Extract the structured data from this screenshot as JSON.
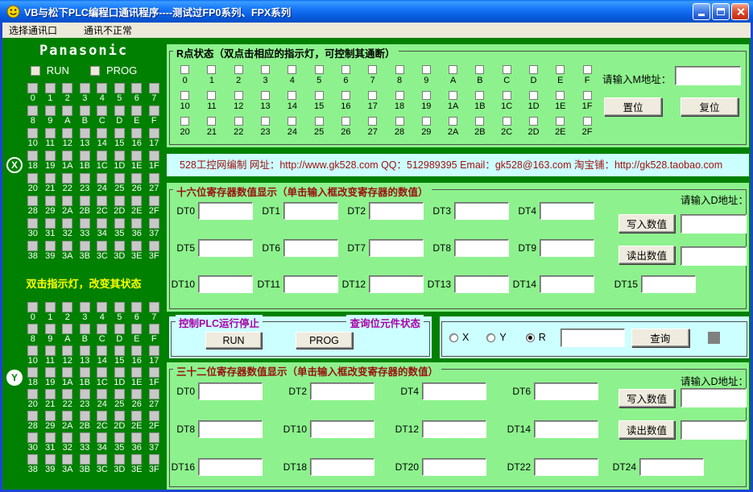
{
  "window": {
    "title": "VB与松下PLC编程口通讯程序----测试过FP0系列、FPX系列"
  },
  "menu": {
    "items": [
      "选择通讯口",
      "通讯不正常"
    ]
  },
  "left_panel": {
    "brand": "Panasonic",
    "run_label": "RUN",
    "prog_label": "PROG",
    "hint": "双击指示灯，改变其状态",
    "x_badge": "X",
    "y_badge": "Y",
    "grid_labels": [
      "0",
      "1",
      "2",
      "3",
      "4",
      "5",
      "6",
      "7",
      "8",
      "9",
      "A",
      "B",
      "C",
      "D",
      "E",
      "F",
      "10",
      "11",
      "12",
      "13",
      "14",
      "15",
      "16",
      "17",
      "18",
      "19",
      "1A",
      "1B",
      "1C",
      "1D",
      "1E",
      "1F",
      "20",
      "21",
      "22",
      "23",
      "24",
      "25",
      "26",
      "27",
      "28",
      "29",
      "2A",
      "2B",
      "2C",
      "2D",
      "2E",
      "2F",
      "30",
      "31",
      "32",
      "33",
      "34",
      "35",
      "36",
      "37",
      "38",
      "39",
      "3A",
      "3B",
      "3C",
      "3D",
      "3E",
      "3F"
    ]
  },
  "r_section": {
    "title": "R点状态（双点击相应的指示灯，可控制其通断）",
    "point_labels": [
      "0",
      "1",
      "2",
      "3",
      "4",
      "5",
      "6",
      "7",
      "8",
      "9",
      "A",
      "B",
      "C",
      "D",
      "E",
      "F",
      "10",
      "11",
      "12",
      "13",
      "14",
      "15",
      "16",
      "17",
      "18",
      "19",
      "1A",
      "1B",
      "1C",
      "1D",
      "1E",
      "1F",
      "20",
      "21",
      "22",
      "23",
      "24",
      "25",
      "26",
      "27",
      "28",
      "29",
      "2A",
      "2B",
      "2C",
      "2D",
      "2E",
      "2F"
    ],
    "m_address_label": "请输入M地址：",
    "m_address_value": "",
    "set_button": "置位",
    "reset_button": "复位"
  },
  "banner": {
    "text": "528工控网编制 网址：http://www.gk528.com QQ：512989395 Email：gk528@163.com 淘宝铺：http://gk528.taobao.com"
  },
  "reg16": {
    "title": "十六位寄存器数值显示（单击输入框改变寄存器的数值）",
    "d_address_label": "请输入D地址：",
    "write_button": "写入数值",
    "read_button": "读出数值",
    "write_address_value": "",
    "read_address_value": "",
    "row1": [
      "DT0",
      "DT1",
      "DT2",
      "DT3",
      "DT4"
    ],
    "row2": [
      "DT5",
      "DT6",
      "DT7",
      "DT8",
      "DT9"
    ],
    "row3": [
      "DT10",
      "DT11",
      "DT12",
      "DT13",
      "DT14",
      "DT15"
    ]
  },
  "control": {
    "frame_title_left": "控制PLC运行停止",
    "frame_title_right": "查询位元件状态",
    "run_button": "RUN",
    "prog_button": "PROG",
    "radio_x": "X",
    "radio_y": "Y",
    "radio_r": "R",
    "selected": "R",
    "query_value": "",
    "query_button": "查询"
  },
  "reg32": {
    "title": "三十二位寄存器数值显示（单击输入框改变寄存器的数值）",
    "d_address_label": "请输入D地址：",
    "write_button": "写入数值",
    "read_button": "读出数值",
    "write_address_value": "",
    "read_address_value": "",
    "row1": [
      "DT0",
      "DT2",
      "DT4",
      "DT6"
    ],
    "row2": [
      "DT8",
      "DT10",
      "DT12",
      "DT14"
    ],
    "row3": [
      "DT16",
      "DT18",
      "DT20",
      "DT22",
      "DT24"
    ]
  },
  "colors": {
    "panel_green": "#008000",
    "section_green": "#8DF28D",
    "section_cyan": "#CCFFFF",
    "banner_text": "#A01010",
    "frame_title_red": "#991111",
    "frame_title_magenta": "#A800A8",
    "hint_yellow": "#FFFF00",
    "titlebar_blue": "#0D64E8"
  }
}
